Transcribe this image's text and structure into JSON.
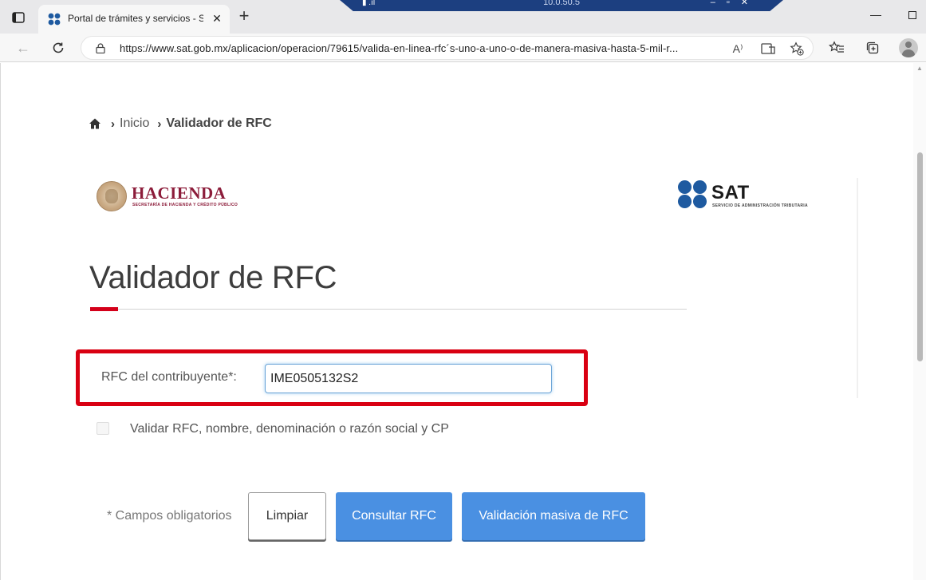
{
  "browser": {
    "tab_title": "Portal de trámites y servicios - SAT",
    "tab_close": "✕",
    "new_tab": "+",
    "url": "https://www.sat.gob.mx/aplicacion/operacion/79615/valida-en-linea-rfc´s-uno-a-uno-o-de-manera-masiva-hasta-5-mil-r...",
    "remote_session_ip": "10.0.50.5",
    "icons": [
      "tab-actions-icon",
      "back-icon",
      "refresh-icon",
      "lock-icon",
      "read-aloud-icon",
      "immersive-reader-icon",
      "add-favorite-icon",
      "favorites-icon",
      "collections-icon",
      "profile-icon"
    ]
  },
  "breadcrumb": {
    "home": "Inicio",
    "current": "Validador de RFC"
  },
  "logos": {
    "hacienda_name": "HACIENDA",
    "hacienda_sub": "SECRETARÍA DE HACIENDA Y CRÉDITO PÚBLICO",
    "sat_name": "SAT",
    "sat_sub": "SERVICIO DE ADMINISTRACIÓN TRIBUTARIA"
  },
  "page": {
    "title": "Validador de RFC",
    "accent_color": "#d4001a"
  },
  "form": {
    "rfc_label": "RFC del contribuyente*:",
    "rfc_value": "IME0505132S2",
    "checkbox_label": "Validar RFC, nombre, denominación o razón social y CP",
    "checkbox_checked": false,
    "required_note": "* Campos obligatorios",
    "btn_clear": "Limpiar",
    "btn_query": "Consultar RFC",
    "btn_mass": "Validación masiva de RFC",
    "button_color": "#4a90e2"
  }
}
